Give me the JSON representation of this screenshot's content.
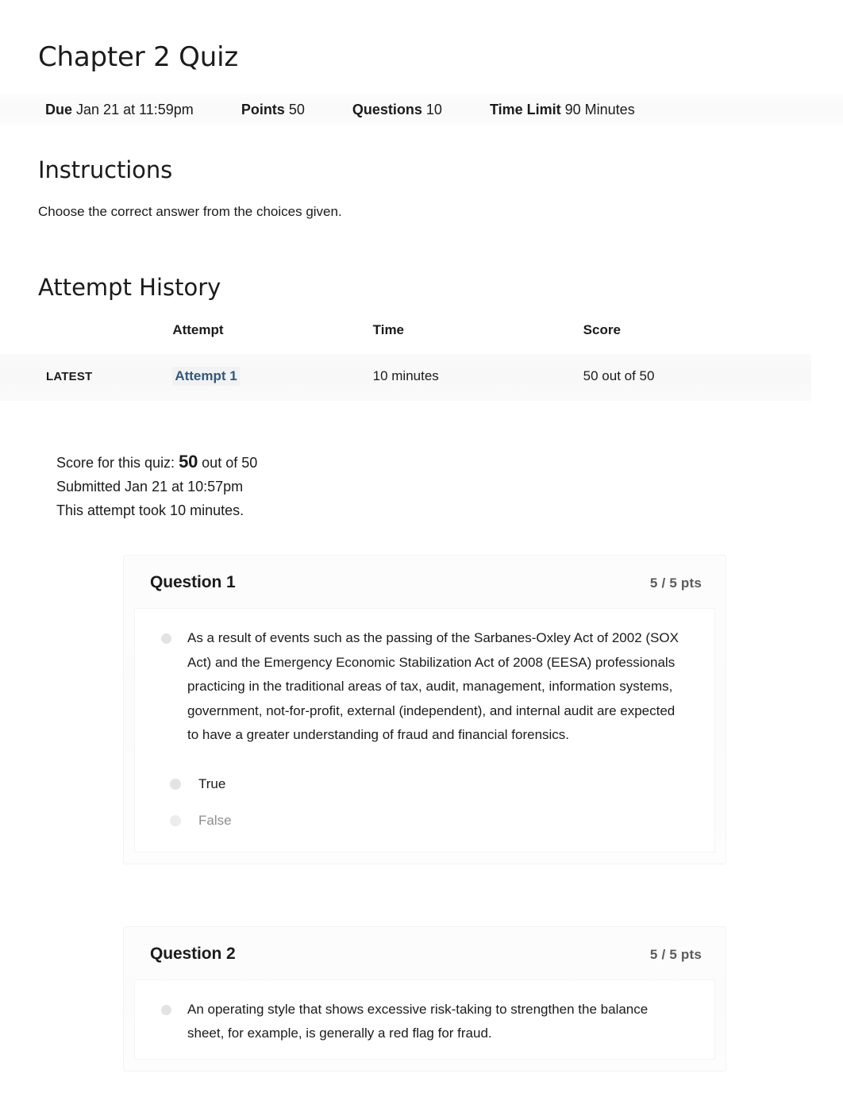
{
  "quiz": {
    "title": "Chapter 2 Quiz",
    "meta": [
      {
        "label": "Due",
        "value": "Jan 21 at 11:59pm"
      },
      {
        "label": "Points",
        "value": "50"
      },
      {
        "label": "Questions",
        "value": "10"
      },
      {
        "label": "Time Limit",
        "value": "90 Minutes"
      }
    ]
  },
  "instructions": {
    "heading": "Instructions",
    "body": "Choose the correct answer from the choices given."
  },
  "attempt_history": {
    "heading": "Attempt History",
    "columns": [
      "",
      "Attempt",
      "Time",
      "Score"
    ],
    "rows": [
      {
        "badge": "LATEST",
        "attempt": "Attempt 1",
        "time": "10 minutes",
        "score": "50 out of 50"
      }
    ]
  },
  "score_summary": {
    "score_prefix": "Score for this quiz:",
    "score_value": "50",
    "score_suffix": "out of 50",
    "submitted": "Submitted Jan 21 at 10:57pm",
    "duration": "This attempt took 10 minutes."
  },
  "questions": [
    {
      "name": "Question 1",
      "points": "5 / 5 pts",
      "text": "As a result of events such as the passing of the Sarbanes-Oxley Act of 2002 (SOX Act) and the Emergency Economic Stabilization Act of 2008 (EESA) professionals practicing in the traditional areas of tax, audit, management, information systems, government, not-for-profit, external (independent), and internal audit are expected to have a greater understanding of fraud and financial forensics.",
      "answers": [
        {
          "label": "True",
          "selected": true
        },
        {
          "label": "False",
          "selected": false
        }
      ]
    },
    {
      "name": "Question 2",
      "points": "5 / 5 pts",
      "text": "An operating style that shows excessive risk-taking to strengthen the balance sheet, for example, is generally a red flag for fraud.",
      "answers": []
    }
  ],
  "colors": {
    "link": "#33577d",
    "points": "#5b5b5b",
    "text": "#1b1b1b",
    "dim_text": "#8d8d8d"
  }
}
